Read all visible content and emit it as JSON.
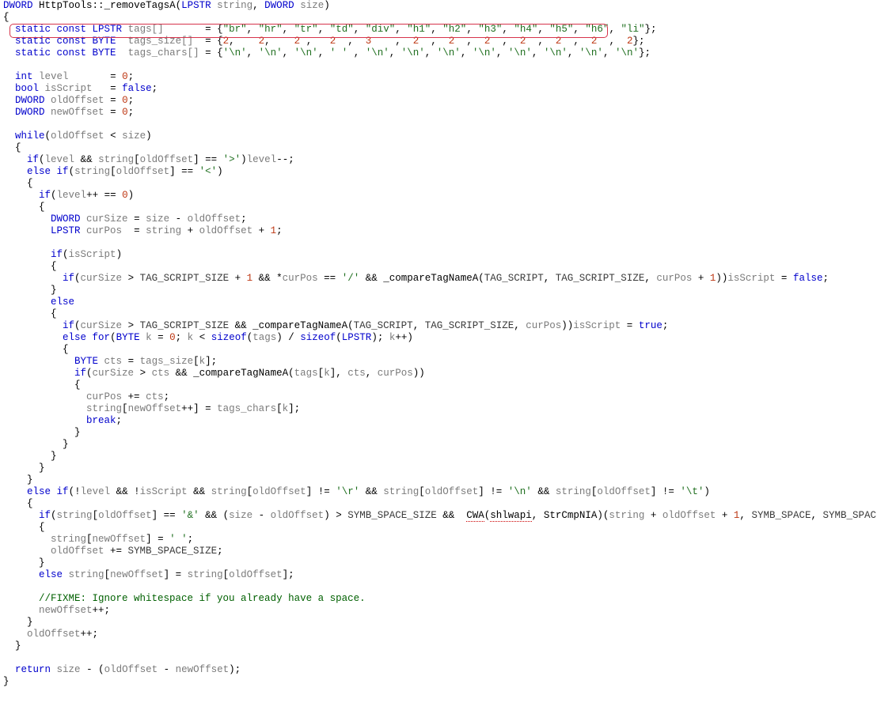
{
  "signature": {
    "ret": "DWORD",
    "cls": "HttpTools",
    "fn": "_removeTagsA",
    "p1t": "LPSTR",
    "p1n": "string",
    "p2t": "DWORD",
    "p2n": "size"
  },
  "tags_decl": {
    "prefix": "static const ",
    "type": "LPSTR",
    "name": "tags[]",
    "vals": [
      "\"br\"",
      "\"hr\"",
      "\"tr\"",
      "\"td\"",
      "\"div\"",
      "\"h1\"",
      "\"h2\"",
      "\"h3\"",
      "\"h4\"",
      "\"h5\"",
      "\"h6\"",
      "\"li\""
    ]
  },
  "tags_size_decl": {
    "prefix": "static const ",
    "type": "BYTE",
    "name": "tags_size[]",
    "vals": [
      "2",
      "2",
      "2",
      "2",
      "3",
      "2",
      "2",
      "2",
      "2",
      "2",
      "2",
      "2"
    ]
  },
  "tags_chars_decl": {
    "prefix": "static const ",
    "type": "BYTE",
    "name": "tags_chars[]",
    "vals": [
      "'\\n'",
      "'\\n'",
      "'\\n'",
      "' '",
      "'\\n'",
      "'\\n'",
      "'\\n'",
      "'\\n'",
      "'\\n'",
      "'\\n'",
      "'\\n'",
      "'\\n'"
    ]
  },
  "decls": {
    "level": {
      "t": "int",
      "n": "level",
      "v": "0"
    },
    "isScript": {
      "t": "bool",
      "n": "isScript",
      "v": "false"
    },
    "oldOffset": {
      "t": "DWORD",
      "n": "oldOffset",
      "v": "0"
    },
    "newOffset": {
      "t": "DWORD",
      "n": "newOffset",
      "v": "0"
    }
  },
  "consts": {
    "TAG_SCRIPT": "TAG_SCRIPT",
    "TAG_SCRIPT_SIZE": "TAG_SCRIPT_SIZE",
    "SYMB_SPACE": "SYMB_SPACE",
    "SYMB_SPACE_SIZE": "SYMB_SPACE_SIZE"
  },
  "calls": {
    "compareTagNameA": "_compareTagNameA",
    "CWA": "CWA",
    "shlwapi": "shlwapi",
    "StrCmpNIA": "StrCmpNIA"
  },
  "comment_fixme": "//FIXME: Ignore whitespace if you already have a space.",
  "kw": {
    "while": "while",
    "if": "if",
    "else": "else",
    "for": "for",
    "break": "break",
    "return": "return",
    "sizeof": "sizeof",
    "true": "true",
    "false": "false"
  },
  "greyId": {
    "string": "string",
    "size": "size",
    "level": "level",
    "isScript": "isScript",
    "oldOffset": "oldOffset",
    "newOffset": "newOffset",
    "curSize": "curSize",
    "curPos": "curPos",
    "cts": "cts",
    "k": "k",
    "tags": "tags",
    "tags_size": "tags_size",
    "tags_chars": "tags_chars"
  },
  "chars": {
    "gt": "'>'",
    "lt": "'<'",
    "cr": "'\\r'",
    "nl": "'\\n'",
    "tab": "'\\t'",
    "amp": "'&'",
    "sp": "' '",
    "slash": "'/'"
  },
  "nums": {
    "0": "0",
    "1": "1"
  }
}
